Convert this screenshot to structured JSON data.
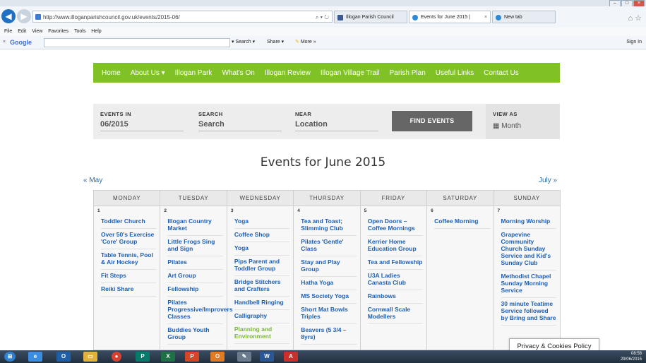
{
  "browser": {
    "url": "http://www.illoganparishcouncil.gov.uk/events/2015-06/",
    "tabs": [
      {
        "label": "Illogan Parish Council",
        "color": "#3b5998"
      },
      {
        "label": "Events for June 2015 |",
        "color": "#2d8ad8"
      },
      {
        "label": "New tab",
        "color": "#2d8ad8"
      }
    ],
    "menu": [
      "File",
      "Edit",
      "View",
      "Favorites",
      "Tools",
      "Help"
    ],
    "google_toolbar": {
      "logo": "Google",
      "search_label": "Search",
      "share_label": "Share",
      "more_label": "More »",
      "sign_in": "Sign In"
    }
  },
  "site_nav": [
    "Home",
    "About Us ▾",
    "Illogan Park",
    "What's On",
    "Illogan Review",
    "Illogan Village Trail",
    "Parish Plan",
    "Useful Links",
    "Contact Us"
  ],
  "filters": {
    "events_in": {
      "label": "EVENTS IN",
      "value": "06/2015"
    },
    "search": {
      "label": "SEARCH",
      "value": "Search"
    },
    "near": {
      "label": "NEAR",
      "value": "Location"
    },
    "find_button": "FIND EVENTS",
    "view_as": {
      "label": "VIEW AS",
      "value": "Month"
    }
  },
  "page_title": "Events for June 2015",
  "prev_month": "« May",
  "next_month": "July »",
  "calendar": {
    "days": [
      "MONDAY",
      "TUESDAY",
      "WEDNESDAY",
      "THURSDAY",
      "FRIDAY",
      "SATURDAY",
      "SUNDAY"
    ],
    "cells": [
      {
        "day": "1",
        "events": [
          "Toddler Church",
          "Over 50's Exercise 'Core' Group",
          "Table Tennis, Pool & Air Hockey",
          "Fit Steps",
          "Reiki Share"
        ]
      },
      {
        "day": "2",
        "events": [
          "Illogan Country Market",
          "Little Frogs Sing and Sign",
          "Pilates",
          "Art Group",
          "Fellowship",
          "Pilates Progressive/Improvers Classes",
          "Buddies Youth Group"
        ]
      },
      {
        "day": "3",
        "events": [
          "Yoga",
          "Coffee Shop",
          "Yoga",
          "Pips Parent and Toddler Group",
          "Bridge Stitchers and Crafters",
          "Handbell Ringing",
          "Calligraphy",
          "Planning and Environment"
        ]
      },
      {
        "day": "4",
        "events": [
          "Tea and Toast; Slimming Club",
          "Pilates 'Gentle' Class",
          "Stay and Play Group",
          "Hatha Yoga",
          "MS Society Yoga",
          "Short Mat Bowls Triples",
          "Beavers (5 3/4 – 8yrs)"
        ]
      },
      {
        "day": "5",
        "events": [
          "Open Doors – Coffee Mornings",
          "Kerrier Home Education Group",
          "Tea and Fellowship",
          "U3A Ladies Canasta Club",
          "Rainbows",
          "Cornwall Scale Modellers"
        ]
      },
      {
        "day": "6",
        "events": [
          "Coffee Morning"
        ]
      },
      {
        "day": "7",
        "events": [
          "Morning Worship",
          "Grapevine Community Church Sunday Service and Kid's Sunday Club",
          "Methodist Chapel Sunday Morning Service",
          "30 minute Teatime Service followed by Bring and Share"
        ]
      }
    ]
  },
  "privacy_label": "Privacy & Cookies Policy",
  "taskbar": {
    "time": "08:58",
    "date": "29/06/2015"
  }
}
